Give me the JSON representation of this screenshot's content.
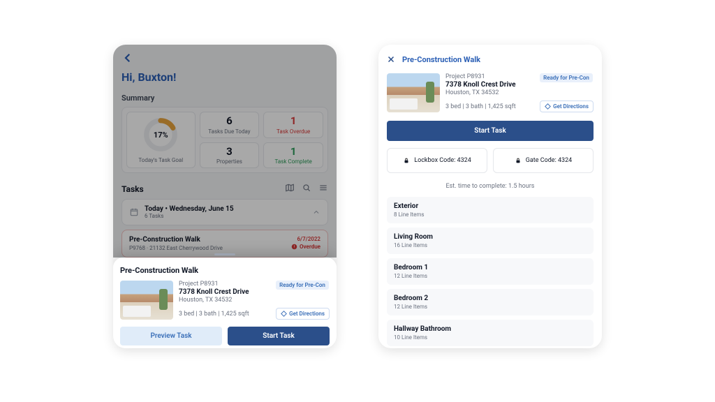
{
  "left": {
    "greeting": "Hi, Buxton!",
    "summary": {
      "title": "Summary",
      "goal_pct": "17%",
      "goal_label": "Today's Task Goal",
      "tasks_due": {
        "value": "6",
        "label": "Tasks Due Today"
      },
      "overdue": {
        "value": "1",
        "label": "Task Overdue"
      },
      "properties": {
        "value": "3",
        "label": "Properties"
      },
      "complete": {
        "value": "1",
        "label": "Task Complete"
      }
    },
    "tasks": {
      "title": "Tasks",
      "date_line1": "Today • Wednesday, June 15",
      "date_line2": "6 Tasks",
      "item": {
        "title": "Pre-Construction Walk",
        "sub": "P9768 · 21132 East Cherrywood Drive",
        "date": "6/7/2022",
        "badge": "Overdue"
      }
    },
    "sheet": {
      "title": "Pre-Construction Walk",
      "project": "Project P8931",
      "address": "7378 Knoll Crest Drive",
      "city": "Houston, TX 34532",
      "specs": "3 bed | 3 bath | 1,425 sqft",
      "chip": "Ready for Pre-Con",
      "directions": "Get Directions",
      "preview": "Preview Task",
      "start": "Start Task"
    }
  },
  "right": {
    "title": "Pre-Construction Walk",
    "project": "Project P8931",
    "address": "7378 Knoll Crest Drive",
    "city": "Houston, TX 34532",
    "specs": "3 bed | 3 bath | 1,425 sqft",
    "chip": "Ready for Pre-Con",
    "directions": "Get Directions",
    "start": "Start Task",
    "lockbox": "Lockbox Code: 4324",
    "gate": "Gate Code: 4324",
    "est": "Est. time to complete: 1.5 hours",
    "rooms": [
      {
        "name": "Exterior",
        "items": "8 Line Items"
      },
      {
        "name": "Living Room",
        "items": "16 Line Items"
      },
      {
        "name": "Bedroom 1",
        "items": "12 Line Items"
      },
      {
        "name": "Bedroom 2",
        "items": "12 Line Items"
      },
      {
        "name": "Hallway Bathroom",
        "items": "10 Line Items"
      }
    ]
  }
}
